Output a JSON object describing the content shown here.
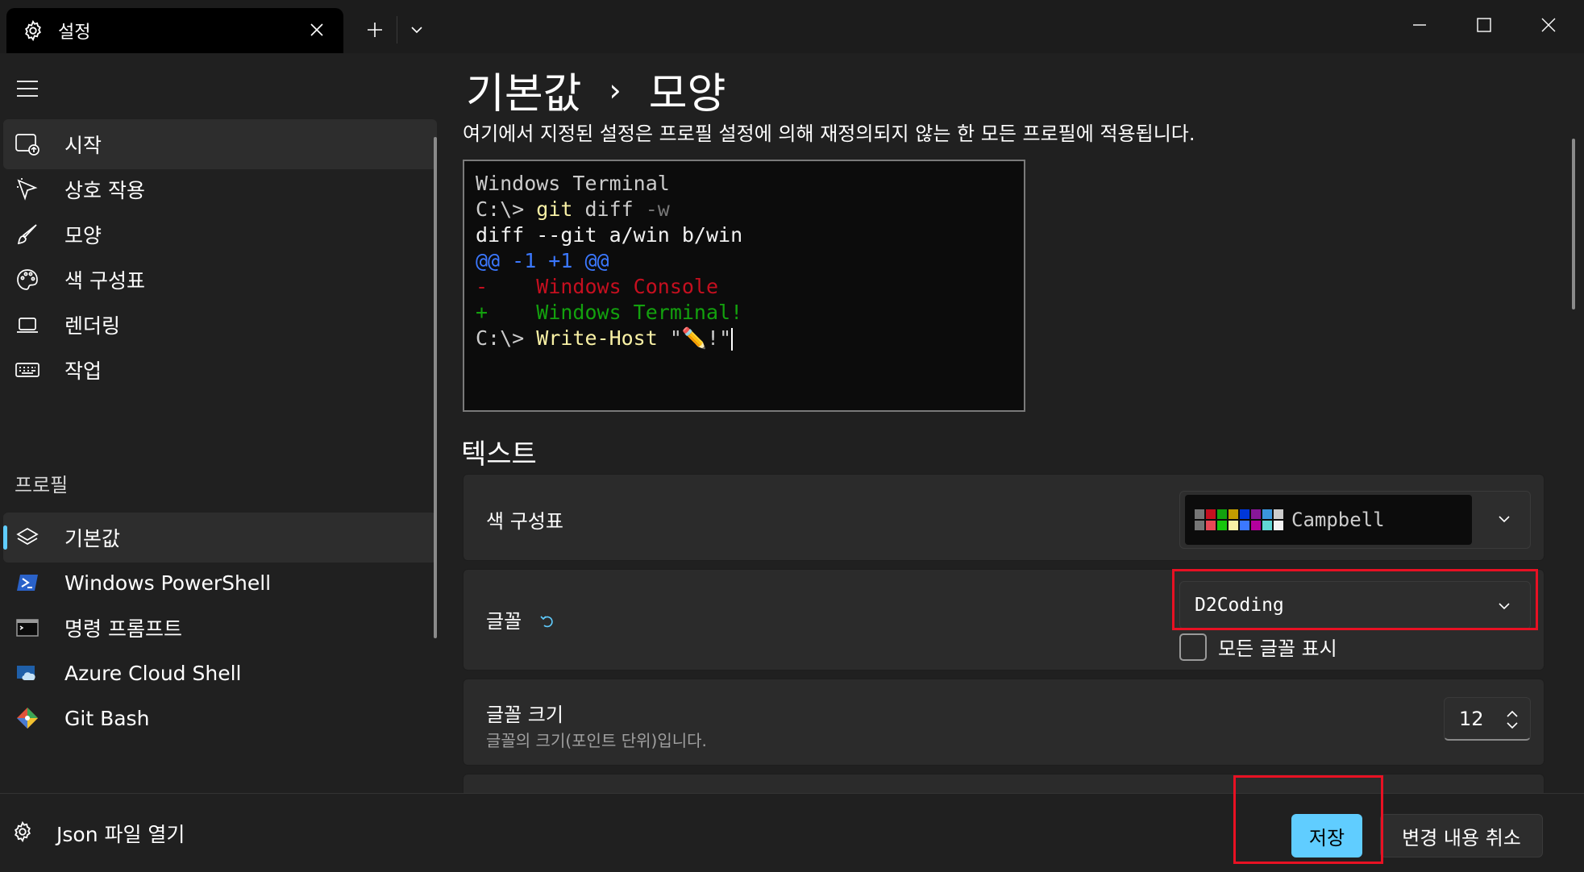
{
  "window": {
    "tab_title": "설정"
  },
  "sidebar": {
    "items": [
      {
        "label": "시작",
        "icon": "startup-icon"
      },
      {
        "label": "상호 작용",
        "icon": "interaction-icon"
      },
      {
        "label": "모양",
        "icon": "brush-icon"
      },
      {
        "label": "색 구성표",
        "icon": "palette-icon"
      },
      {
        "label": "렌더링",
        "icon": "laptop-icon"
      },
      {
        "label": "작업",
        "icon": "keyboard-icon"
      }
    ],
    "section_profiles": "프로필",
    "profiles": [
      {
        "label": "기본값",
        "icon": "layers-icon",
        "selected": true
      },
      {
        "label": "Windows PowerShell",
        "icon": "powershell-icon"
      },
      {
        "label": "명령 프롬프트",
        "icon": "cmd-icon"
      },
      {
        "label": "Azure Cloud Shell",
        "icon": "azure-icon"
      },
      {
        "label": "Git Bash",
        "icon": "git-icon"
      }
    ],
    "json_link": "Json 파일 열기"
  },
  "main": {
    "breadcrumb": [
      "기본값",
      "모양"
    ],
    "breadcrumb_sep": "›",
    "subtitle": "여기에서 지정된 설정은 프로필 설정에 의해 재정의되지 않는 한 모든 프로필에 적용됩니다.",
    "preview": {
      "line1": "Windows Terminal",
      "line2_prompt": "C:\\> ",
      "line2_cmd": "git",
      "line2_args": " diff ",
      "line2_flag": "-w",
      "line3": "diff --git a/win b/win",
      "line4_a": "@@ -1 +1 @@",
      "line5_sign": "-",
      "line5_text": "    Windows Console",
      "line6_sign": "+",
      "line6_text": "    Windows Terminal!",
      "line7_prompt": "C:\\> ",
      "line7_cmd": "Write-Host",
      "line7_str": " \"✏️!\""
    },
    "section_text": "텍스트",
    "color_scheme": {
      "label": "색 구성표",
      "value": "Campbell",
      "swatch_colors": [
        "#767676",
        "#c50f1f",
        "#13a10e",
        "#c19c00",
        "#0037da",
        "#881798",
        "#3a96dd",
        "#cccccc",
        "#767676",
        "#e74856",
        "#16c60c",
        "#f9f1a5",
        "#3b78ff",
        "#b4009e",
        "#61d6d6",
        "#f2f2f2"
      ]
    },
    "font": {
      "label": "글꼴",
      "value": "D2Coding",
      "show_all_label": "모든 글꼴 표시",
      "show_all_checked": false
    },
    "font_size": {
      "label": "글꼴 크기",
      "description": "글꼴의 크기(포인트 단위)입니다.",
      "value": "12"
    }
  },
  "footer": {
    "save": "저장",
    "discard": "변경 내용 취소"
  },
  "colors": {
    "accent": "#60cdff",
    "highlight_box": "#e81123"
  }
}
